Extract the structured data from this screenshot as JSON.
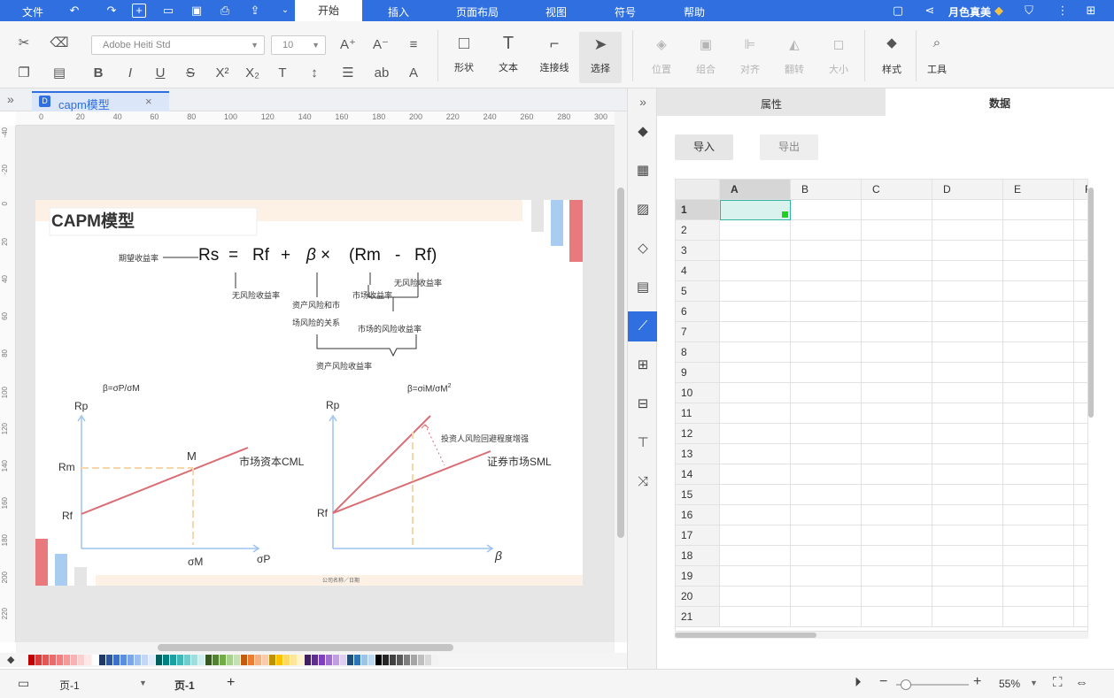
{
  "menu": {
    "file": "文件",
    "tabs": [
      "开始",
      "插入",
      "页面布局",
      "视图",
      "符号",
      "帮助"
    ],
    "user": "月色真美"
  },
  "ribbon": {
    "font_family": "Adobe Heiti Std",
    "font_size": "10",
    "tools": [
      "形状",
      "文本",
      "连接线",
      "选择"
    ],
    "arrange": [
      "位置",
      "组合",
      "对齐",
      "翻转",
      "大小"
    ],
    "style": "样式",
    "tools_group": "工具"
  },
  "document_tab": {
    "name": "capm模型",
    "close": "×"
  },
  "ruler_h": [
    "0",
    "20",
    "40",
    "60",
    "80",
    "100",
    "120",
    "140",
    "160",
    "180",
    "200",
    "220",
    "240",
    "260",
    "280",
    "300"
  ],
  "ruler_v": [
    "-40",
    "-20",
    "0",
    "20",
    "40",
    "60",
    "80",
    "100",
    "120",
    "140",
    "160",
    "180",
    "200",
    "220"
  ],
  "diagram": {
    "title": "CAPM模型",
    "formula_left": "期望收益率",
    "formula": [
      "Rs",
      "=",
      "Rf",
      "+",
      "β",
      "×",
      "(Rm",
      "-",
      "Rf)"
    ],
    "labels": {
      "risk_free": "无风险收益率",
      "risk_free2": "无风险收益率",
      "relation1": "资产风险和市",
      "relation2": "场风险的关系",
      "market_return": "市场收益率",
      "market_premium": "市场的风险收益率",
      "asset_premium": "资产风险收益率"
    },
    "cml": {
      "formula": "β=σP/σM",
      "y_axis": "Rp",
      "rm": "Rm",
      "rf": "Rf",
      "m": "M",
      "line": "市场资本CML",
      "sigma_m": "σM",
      "sigma_p": "σP"
    },
    "sml": {
      "formula": "β=σiM/σM",
      "formula_sup": "2",
      "y_axis": "Rp",
      "rf": "Rf",
      "note": "投资人风险回避程度增强",
      "line": "证券市场SML",
      "x_axis": "β"
    },
    "footer": "公司名称／日期"
  },
  "right_panel": {
    "tabs": [
      "属性",
      "数据"
    ],
    "import": "导入",
    "export": "导出",
    "columns": [
      "A",
      "B",
      "C",
      "D",
      "E",
      "F"
    ],
    "rows": [
      "1",
      "2",
      "3",
      "4",
      "5",
      "6",
      "7",
      "8",
      "9",
      "10",
      "11",
      "12",
      "13",
      "14",
      "15",
      "16",
      "17",
      "18",
      "19",
      "20",
      "21"
    ]
  },
  "status": {
    "page_select": "页-1",
    "page_tab": "页-1",
    "add": "+",
    "zoom": "55%"
  },
  "colors": {
    "accent": "#2f6fe0",
    "red": "#e8797d",
    "blue": "#a9cdf0",
    "gray": "#e5e5e5",
    "peach": "#fdf1e6",
    "line_red": "#d96d74",
    "axis_blue": "#9ec4ee",
    "dash": "#f5d7a8"
  }
}
